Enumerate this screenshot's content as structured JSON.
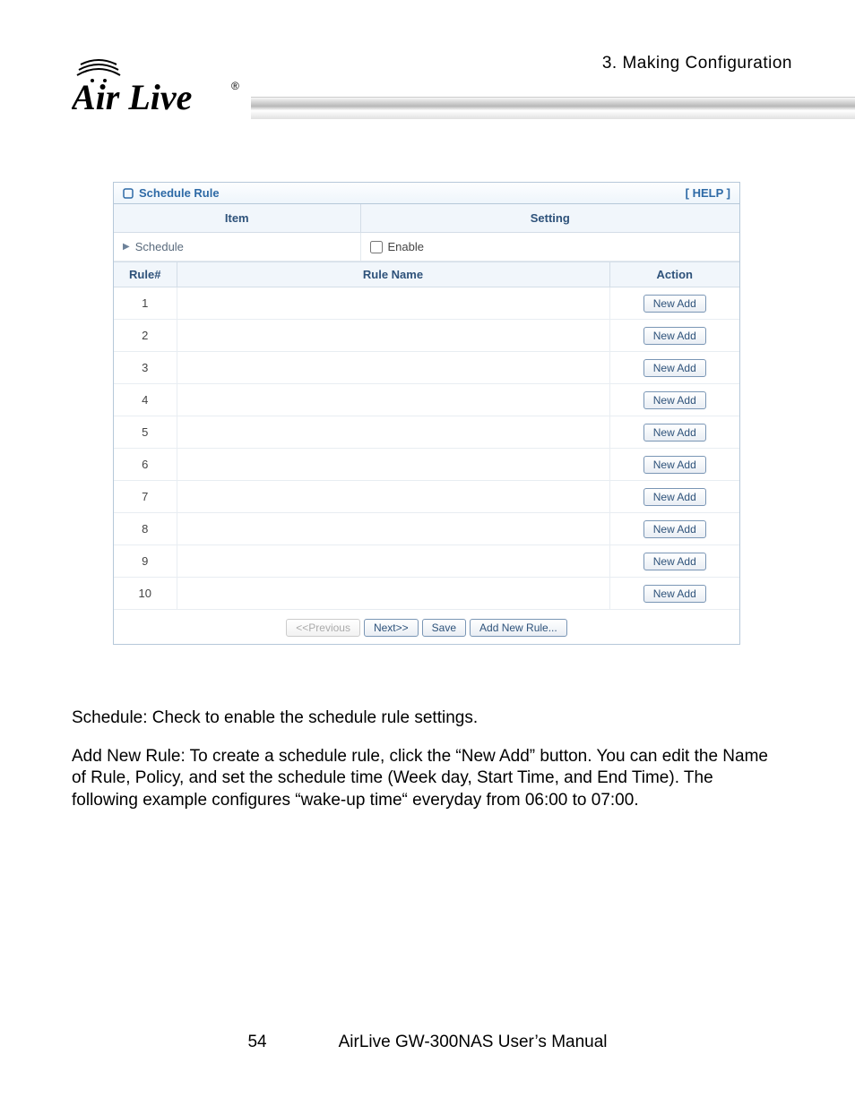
{
  "header": {
    "chapter": "3.  Making  Configuration",
    "logo_text": "Air Live",
    "logo_registered": "®"
  },
  "panel": {
    "title": "Schedule Rule",
    "help": "[ HELP ]",
    "item_header": "Item",
    "setting_header": "Setting",
    "schedule_label": "Schedule",
    "enable_label": "Enable",
    "rule_num_header": "Rule#",
    "rule_name_header": "Rule Name",
    "action_header": "Action",
    "rows": [
      {
        "num": "1",
        "name": "",
        "action": "New Add"
      },
      {
        "num": "2",
        "name": "",
        "action": "New Add"
      },
      {
        "num": "3",
        "name": "",
        "action": "New Add"
      },
      {
        "num": "4",
        "name": "",
        "action": "New Add"
      },
      {
        "num": "5",
        "name": "",
        "action": "New Add"
      },
      {
        "num": "6",
        "name": "",
        "action": "New Add"
      },
      {
        "num": "7",
        "name": "",
        "action": "New Add"
      },
      {
        "num": "8",
        "name": "",
        "action": "New Add"
      },
      {
        "num": "9",
        "name": "",
        "action": "New Add"
      },
      {
        "num": "10",
        "name": "",
        "action": "New Add"
      }
    ],
    "buttons": {
      "previous": "<<Previous",
      "next": "Next>>",
      "save": "Save",
      "add_new": "Add New Rule..."
    }
  },
  "body": {
    "p1": "Schedule: Check to enable the schedule rule settings.",
    "p2": "Add New Rule: To create a schedule rule, click the “New Add” button. You can edit the Name of Rule, Policy, and set the schedule time (Week day, Start Time, and End Time). The following example configures “wake-up time“ everyday from 06:00 to 07:00."
  },
  "footer": {
    "page": "54",
    "manual": "AirLive GW-300NAS User’s Manual"
  }
}
